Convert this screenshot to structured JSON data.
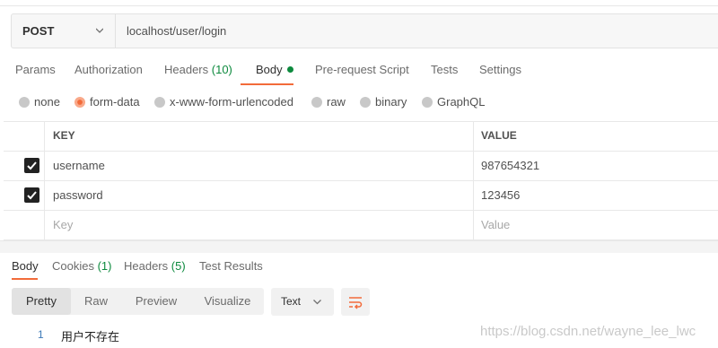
{
  "request": {
    "method": "POST",
    "url": "localhost/user/login"
  },
  "request_tabs": {
    "params": "Params",
    "authorization": "Authorization",
    "headers": "Headers",
    "headers_count": "(10)",
    "body": "Body",
    "prerequest": "Pre-request Script",
    "tests": "Tests",
    "settings": "Settings"
  },
  "body_types": {
    "none": "none",
    "form_data": "form-data",
    "urlencoded": "x-www-form-urlencoded",
    "raw": "raw",
    "binary": "binary",
    "graphql": "GraphQL",
    "selected": "form-data"
  },
  "form_table": {
    "key_header": "KEY",
    "value_header": "VALUE",
    "rows": [
      {
        "key": "username",
        "value": "987654321",
        "checked": true
      },
      {
        "key": "password",
        "value": "123456",
        "checked": true
      }
    ],
    "key_placeholder": "Key",
    "value_placeholder": "Value"
  },
  "response_tabs": {
    "body": "Body",
    "cookies": "Cookies",
    "cookies_count": "(1)",
    "headers": "Headers",
    "headers_count": "(5)",
    "test_results": "Test Results"
  },
  "view_modes": {
    "pretty": "Pretty",
    "raw": "Raw",
    "preview": "Preview",
    "visualize": "Visualize",
    "selected": "Pretty"
  },
  "format": "Text",
  "response": {
    "line_number": "1",
    "text": "用户不存在"
  },
  "watermark": "https://blog.csdn.net/wayne_lee_lwc",
  "colors": {
    "accent": "#f26b3a",
    "count_green": "#0d8a3e"
  }
}
